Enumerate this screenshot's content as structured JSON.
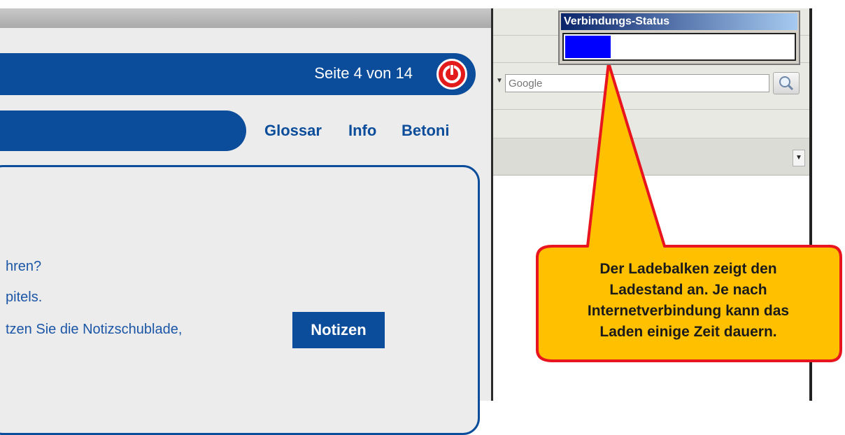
{
  "app": {
    "page_indicator": "Seite 4 von 14",
    "nav_links": [
      "Glossar",
      "Info",
      "Betoni"
    ],
    "content_lines": [
      "hren?",
      "pitels.",
      "tzen Sie die Notizschublade,"
    ],
    "notes_button_label": "Notizen"
  },
  "browser": {
    "search_placeholder": "Google"
  },
  "status_window": {
    "title": "Verbindungs-Status",
    "progress_fraction": 0.2
  },
  "callout": {
    "lines": [
      "Der Ladebalken zeigt den",
      "Ladestand an. Je nach",
      "Internetverbindung kann das",
      "Laden einige Zeit dauern."
    ],
    "fill_color": "#ffc000",
    "border_color": "#e8141e"
  },
  "colors": {
    "brand_blue": "#0b4d9a",
    "progress_blue": "#0000ff",
    "exit_red": "#e31b1b"
  }
}
